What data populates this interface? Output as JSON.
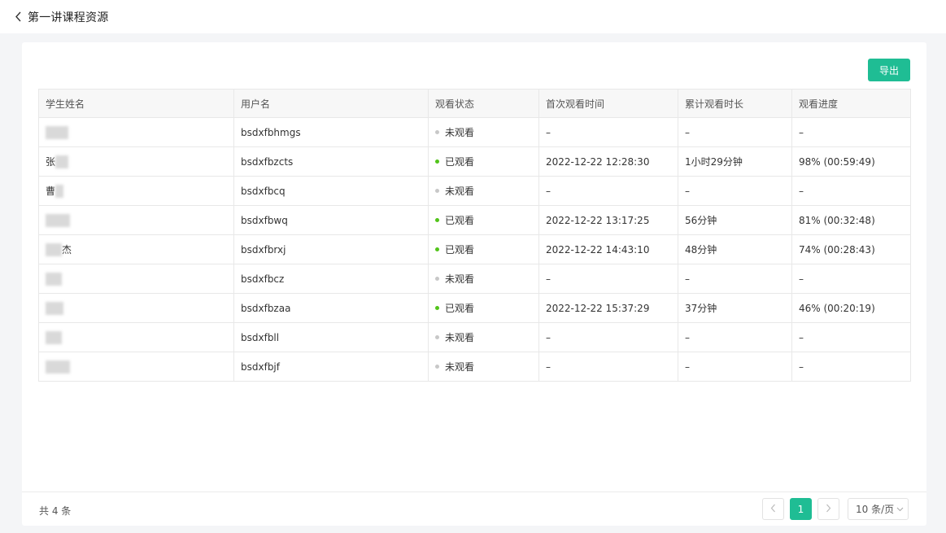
{
  "header": {
    "back_icon": "chevron-left-icon",
    "title": "第一讲课程资源"
  },
  "toolbar": {
    "export_label": "导出"
  },
  "table": {
    "columns": [
      "学生姓名",
      "用户名",
      "观看状态",
      "首次观看时间",
      "累计观看时长",
      "观看进度"
    ],
    "rows": [
      {
        "name": "",
        "username": "bsdxfbhmgs",
        "status": "未观看",
        "watched": false,
        "first_time": "–",
        "duration": "–",
        "progress": "–"
      },
      {
        "name": "张",
        "username": "bsdxfbzcts",
        "status": "已观看",
        "watched": true,
        "first_time": "2022-12-22  12:28:30",
        "duration": "1小时29分钟",
        "progress": "98% (00:59:49)"
      },
      {
        "name": "曹",
        "username": "bsdxfbcq",
        "status": "未观看",
        "watched": false,
        "first_time": "–",
        "duration": "–",
        "progress": "–"
      },
      {
        "name": "",
        "username": "bsdxfbwq",
        "status": "已观看",
        "watched": true,
        "first_time": "2022-12-22  13:17:25",
        "duration": "56分钟",
        "progress": "81% (00:32:48)"
      },
      {
        "name": "杰",
        "username": "bsdxfbrxj",
        "status": "已观看",
        "watched": true,
        "first_time": "2022-12-22  14:43:10",
        "duration": "48分钟",
        "progress": "74% (00:28:43)"
      },
      {
        "name": "",
        "username": "bsdxfbcz",
        "status": "未观看",
        "watched": false,
        "first_time": "–",
        "duration": "–",
        "progress": "–"
      },
      {
        "name": "",
        "username": "bsdxfbzaa",
        "status": "已观看",
        "watched": true,
        "first_time": "2022-12-22  15:37:29",
        "duration": "37分钟",
        "progress": "46% (00:20:19)"
      },
      {
        "name": "",
        "username": "bsdxfbll",
        "status": "未观看",
        "watched": false,
        "first_time": "–",
        "duration": "–",
        "progress": "–"
      },
      {
        "name": "",
        "username": "bsdxfbjf",
        "status": "未观看",
        "watched": false,
        "first_time": "–",
        "duration": "–",
        "progress": "–"
      }
    ]
  },
  "footer": {
    "total": "共 4 条",
    "current_page": "1",
    "page_size": "10 条/页",
    "prev_icon": "chevron-left-icon",
    "next_icon": "chevron-right-icon"
  },
  "colors": {
    "accent": "#1fbd94",
    "watched_dot": "#52c41a",
    "unwatched_dot": "#c8c8c8"
  }
}
